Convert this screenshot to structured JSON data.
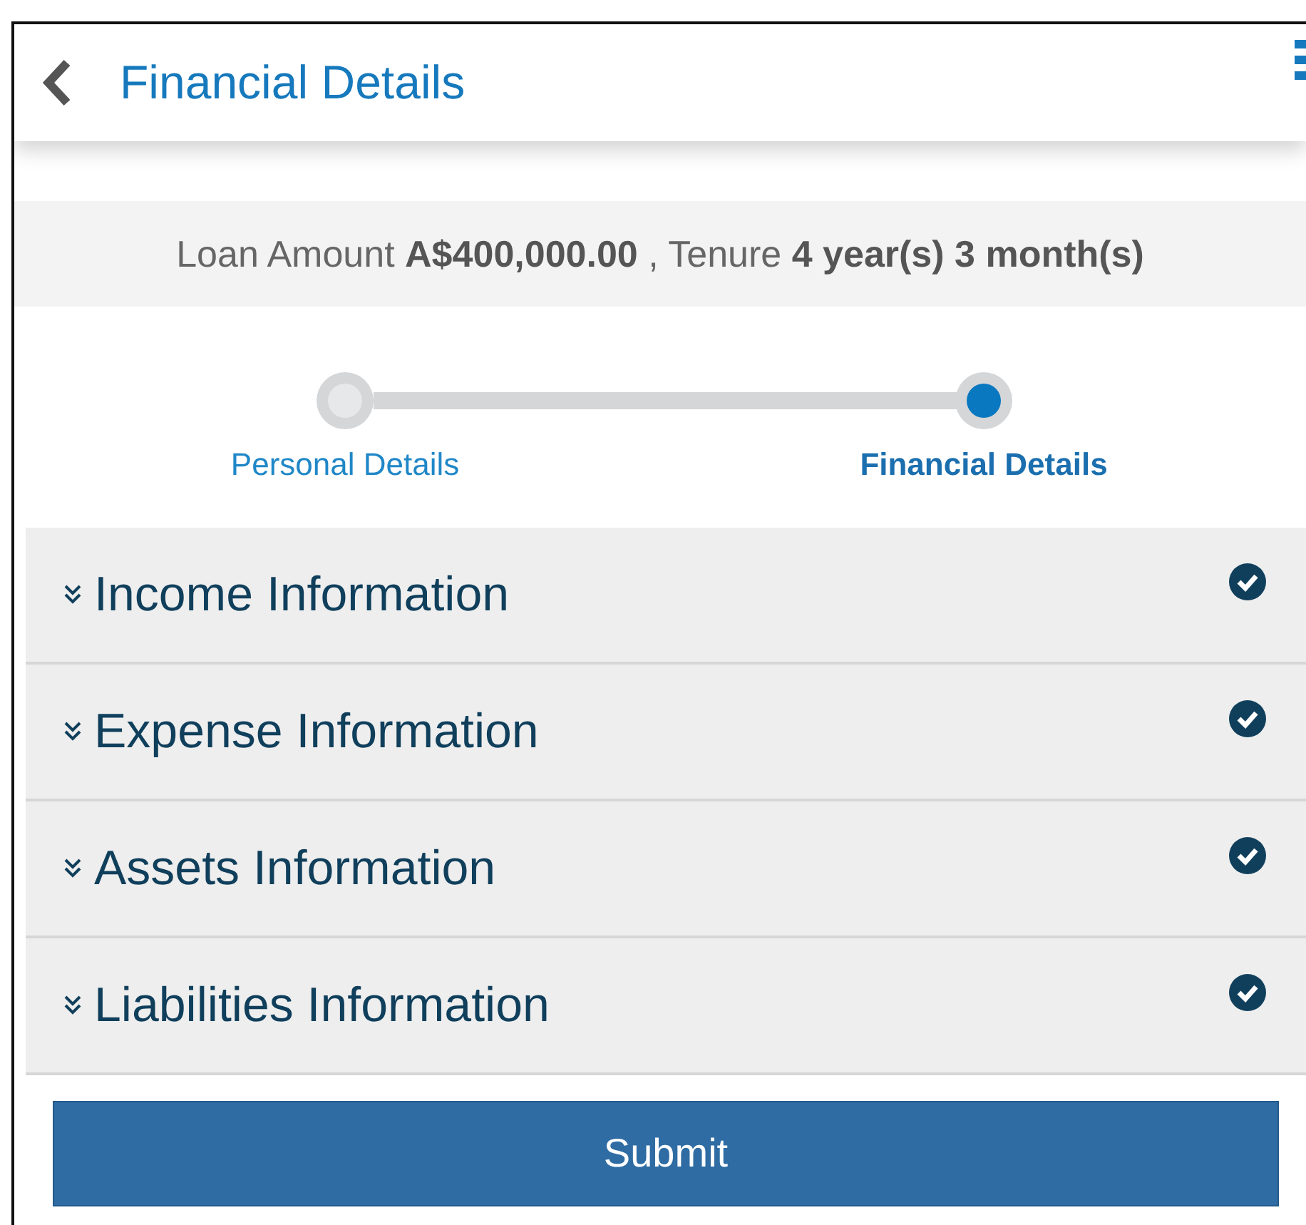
{
  "header": {
    "title": "Financial Details"
  },
  "summary": "Loan Amount **A$400,000.00** , Tenure **4 year(s) 3 month(s)**",
  "steps": [
    {
      "label": "Personal Details",
      "selected": false
    },
    {
      "label": "Financial Details",
      "selected": true
    }
  ],
  "sections": [
    {
      "title": "Income Information",
      "completed": true
    },
    {
      "title": "Expense Information",
      "completed": true
    },
    {
      "title": "Assets Information",
      "completed": true
    },
    {
      "title": "Liabilities Information",
      "completed": true
    }
  ],
  "submit_button": "Submit"
}
